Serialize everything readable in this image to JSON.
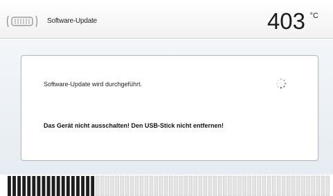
{
  "header": {
    "title": "Software-Update",
    "temperature": "403",
    "unit": "°C",
    "logo_icon": "furnace-chamber-icon"
  },
  "dialog": {
    "message": "Software-Update wird durchgeführt.",
    "warning": "Das Gerät nicht ausschalten! Den USB-Stick nicht entfernen!",
    "spinner_icon": "loading-spinner-icon"
  },
  "progress": {
    "fraction": 0.27
  },
  "colors": {
    "progress_filled": "#1e1e1e",
    "progress_empty": "#e4e4e4",
    "background": "#eef2f5"
  }
}
